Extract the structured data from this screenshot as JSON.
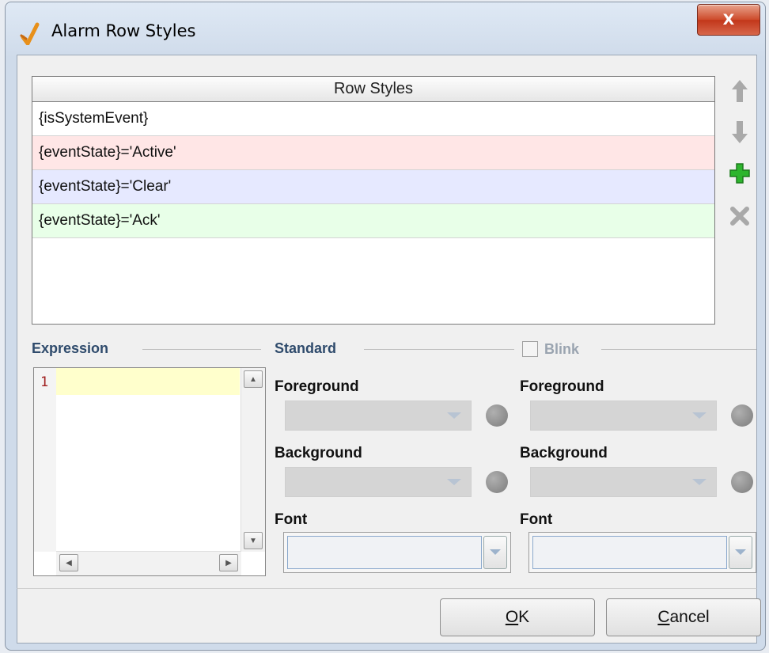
{
  "window": {
    "title": "Alarm Row Styles",
    "close_label": "X"
  },
  "table": {
    "header": "Row Styles",
    "rows": [
      {
        "label": "{isSystemEvent}",
        "color": "#ffffff"
      },
      {
        "label": "{eventState}='Active'",
        "color": "#ffe6e6"
      },
      {
        "label": "{eventState}='Clear'",
        "color": "#e6e9ff"
      },
      {
        "label": "{eventState}='Ack'",
        "color": "#e8ffe8"
      }
    ]
  },
  "side_buttons": {
    "up_icon": "arrow-up-icon",
    "down_icon": "arrow-down-icon",
    "add_icon": "plus-icon",
    "remove_icon": "x-icon"
  },
  "expression": {
    "section_label": "Expression",
    "line_number": "1",
    "value": ""
  },
  "standard": {
    "section_label": "Standard",
    "foreground_label": "Foreground",
    "background_label": "Background",
    "font_label": "Font"
  },
  "blink": {
    "section_label": "Blink",
    "checked": false,
    "foreground_label": "Foreground",
    "background_label": "Background",
    "font_label": "Font"
  },
  "buttons": {
    "ok_mnemonic": "O",
    "ok_rest": "K",
    "cancel_mnemonic": "C",
    "cancel_rest": "ancel"
  },
  "colors": {
    "accent": "#2f4b6c",
    "add": "#2db52d",
    "arrows": "#a9a9a9"
  }
}
